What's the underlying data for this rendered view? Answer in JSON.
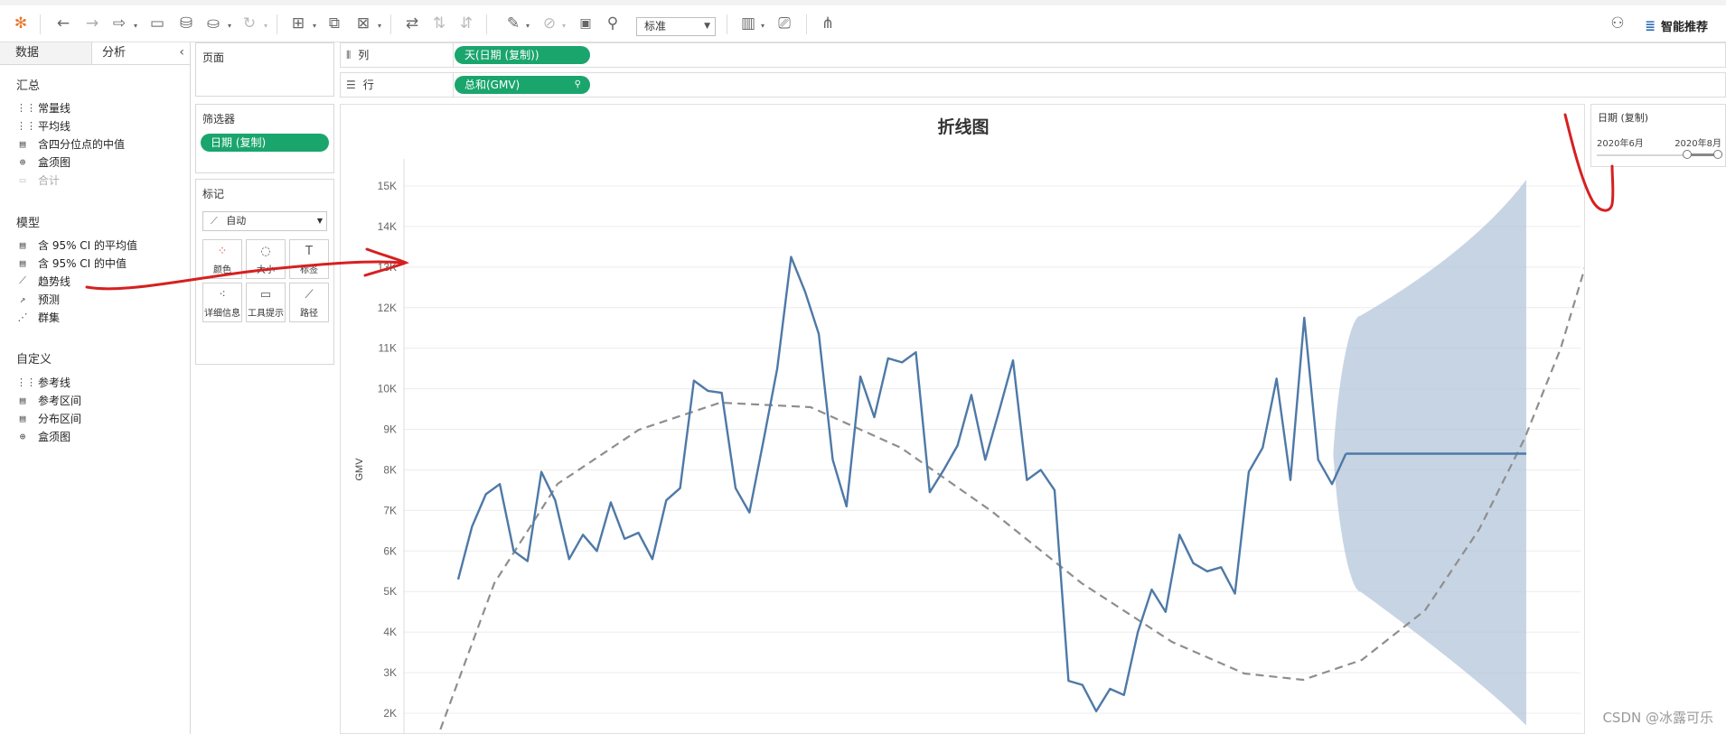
{
  "toolbar": {
    "fit_value": "标准",
    "smart_label": "智能推荐"
  },
  "left_pane": {
    "tabs": [
      "数据",
      "分析"
    ],
    "sections": {
      "summary": {
        "title": "汇总",
        "items": [
          {
            "label": "常量线",
            "icon": "constant-line-icon",
            "enabled": true
          },
          {
            "label": "平均线",
            "icon": "average-line-icon",
            "enabled": true
          },
          {
            "label": "含四分位点的中值",
            "icon": "median-quartiles-icon",
            "enabled": true
          },
          {
            "label": "盒须图",
            "icon": "boxplot-icon",
            "enabled": true
          },
          {
            "label": "合计",
            "icon": "totals-icon",
            "enabled": false
          }
        ]
      },
      "model": {
        "title": "模型",
        "items": [
          {
            "label": "含 95% CI 的平均值",
            "icon": "average-ci-icon"
          },
          {
            "label": "含 95% CI 的中值",
            "icon": "median-ci-icon"
          },
          {
            "label": "趋势线",
            "icon": "trendline-icon"
          },
          {
            "label": "预测",
            "icon": "forecast-icon"
          },
          {
            "label": "群集",
            "icon": "cluster-icon"
          }
        ]
      },
      "custom": {
        "title": "自定义",
        "items": [
          {
            "label": "参考线",
            "icon": "reference-line-icon"
          },
          {
            "label": "参考区间",
            "icon": "reference-band-icon"
          },
          {
            "label": "分布区间",
            "icon": "distribution-band-icon"
          },
          {
            "label": "盒须图",
            "icon": "boxplot-icon"
          }
        ]
      }
    }
  },
  "pages_card": {
    "title": "页面"
  },
  "filters_card": {
    "title": "筛选器",
    "pill": "日期 (复制)"
  },
  "marks_card": {
    "title": "标记",
    "mark_type": "自动",
    "buttons": [
      "颜色",
      "大小",
      "标签",
      "详细信息",
      "工具提示",
      "路径"
    ]
  },
  "shelves": {
    "columns": {
      "label": "列",
      "pill": "天(日期 (复制))"
    },
    "rows": {
      "label": "行",
      "pill": "总和(GMV)"
    }
  },
  "date_filter": {
    "title": "日期 (复制)",
    "start": "2020年6月",
    "end": "2020年8月"
  },
  "watermark": "CSDN @冰露可乐",
  "chart_data": {
    "type": "line",
    "title": "折线图",
    "ylabel": "GMV",
    "ylim": [
      1500,
      15500
    ],
    "yticks": [
      2000,
      3000,
      4000,
      5000,
      6000,
      7000,
      8000,
      9000,
      10000,
      11000,
      12000,
      13000,
      14000,
      15000
    ],
    "ytick_labels": [
      "2K",
      "3K",
      "4K",
      "5K",
      "6K",
      "7K",
      "8K",
      "9K",
      "10K",
      "11K",
      "12K",
      "13K",
      "14K",
      "15K"
    ],
    "series": [
      {
        "values": [
          5300,
          6600,
          7400,
          7650,
          6000,
          5750,
          7950,
          7250,
          5800,
          6400,
          6000,
          7200,
          6300,
          6450,
          5800,
          7250,
          7550,
          10200,
          9950,
          9900,
          7550,
          6950,
          8700,
          10500,
          13250,
          12400,
          11350,
          8250,
          7100,
          10300,
          9300,
          10750,
          10650,
          10900,
          7450,
          8000,
          8600,
          9850,
          8250,
          9450,
          10700,
          7750,
          8000,
          7500,
          2800,
          2700,
          2050,
          2600,
          2450,
          4000,
          5050,
          4500,
          6400,
          5700,
          5500,
          5600,
          4950,
          7950,
          8550,
          10250,
          7750,
          11750,
          8250,
          7650,
          8400
        ]
      },
      {
        "type": "forecast",
        "values": [
          8400,
          8400,
          8400,
          8400,
          8400,
          8400,
          8400,
          8400,
          8400,
          8400,
          8400,
          8400,
          8400,
          8400
        ]
      }
    ],
    "forecast_band": {
      "start_upper": 11800,
      "start_lower": 5000,
      "end_upper": 15150,
      "end_lower": 1700
    },
    "trend_line": {
      "style": "dashed",
      "color": "#8e8e8e",
      "kind": "polynomial"
    },
    "grid": true
  },
  "colors": {
    "line": "#4e79a7",
    "band": "#b4c6da",
    "pill": "#1aa56d",
    "annotation": "#d62020"
  }
}
